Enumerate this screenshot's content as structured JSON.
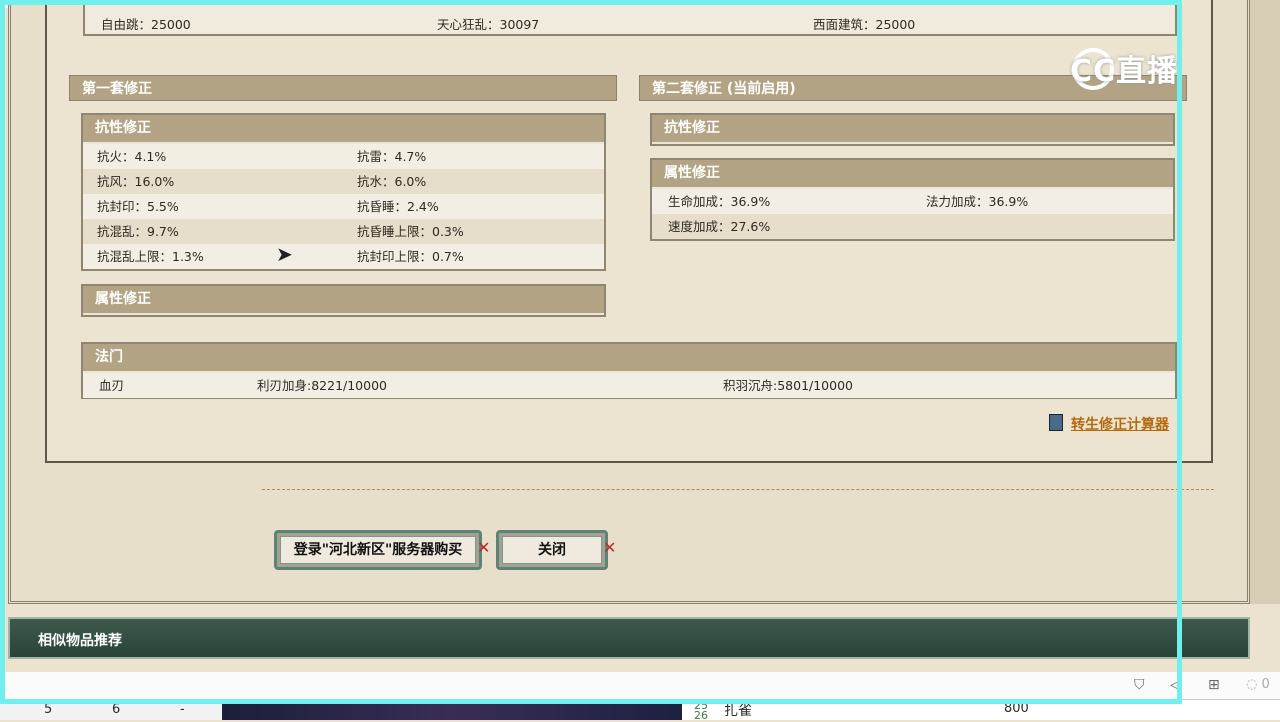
{
  "top_row": {
    "left": "自由跳：25000",
    "middle": "天心狂乱：30097",
    "right": "西面建筑：25000"
  },
  "first_set": {
    "title": "第一套修正",
    "resistance": {
      "title": "抗性修正",
      "rows": [
        [
          "抗火：4.1%",
          "抗雷：4.7%"
        ],
        [
          "抗风：16.0%",
          "抗水：6.0%"
        ],
        [
          "抗封印：5.5%",
          "抗昏睡：2.4%"
        ],
        [
          "抗混乱：9.7%",
          "抗昏睡上限：0.3%"
        ],
        [
          "抗混乱上限：1.3%",
          "抗封印上限：0.7%"
        ]
      ]
    },
    "attribute": {
      "title": "属性修正"
    }
  },
  "second_set": {
    "title": "第二套修正 (当前启用)",
    "resistance": {
      "title": "抗性修正"
    },
    "attribute": {
      "title": "属性修正",
      "rows": [
        [
          "生命加成：36.9%",
          "法力加成：36.9%"
        ],
        [
          "速度加成：27.6%",
          ""
        ]
      ]
    }
  },
  "fa_men": {
    "title": "法门",
    "items": [
      "血刃",
      "利刃加身:8221/10000",
      "积羽沉舟:5801/10000"
    ]
  },
  "calculator_link": "转生修正计算器",
  "buttons": {
    "login_buy": "登录\"河北新区\"服务器购买",
    "close": "关闭"
  },
  "recommend_title": "相似物品推荐",
  "overlay_logo": "CC直播",
  "taskbar": {
    "cells": [
      "5",
      "6",
      "-"
    ],
    "sheet_rows": [
      "25",
      "26"
    ],
    "sheet_text": "扎雀",
    "sheet_value": "800"
  },
  "colors": {
    "header_tan": "#b2a384",
    "link_orange": "#b36b10",
    "button_teal": "#5a8478",
    "recommend_green": "#2b4338",
    "overlay_cyan": "#6ff0ec"
  }
}
